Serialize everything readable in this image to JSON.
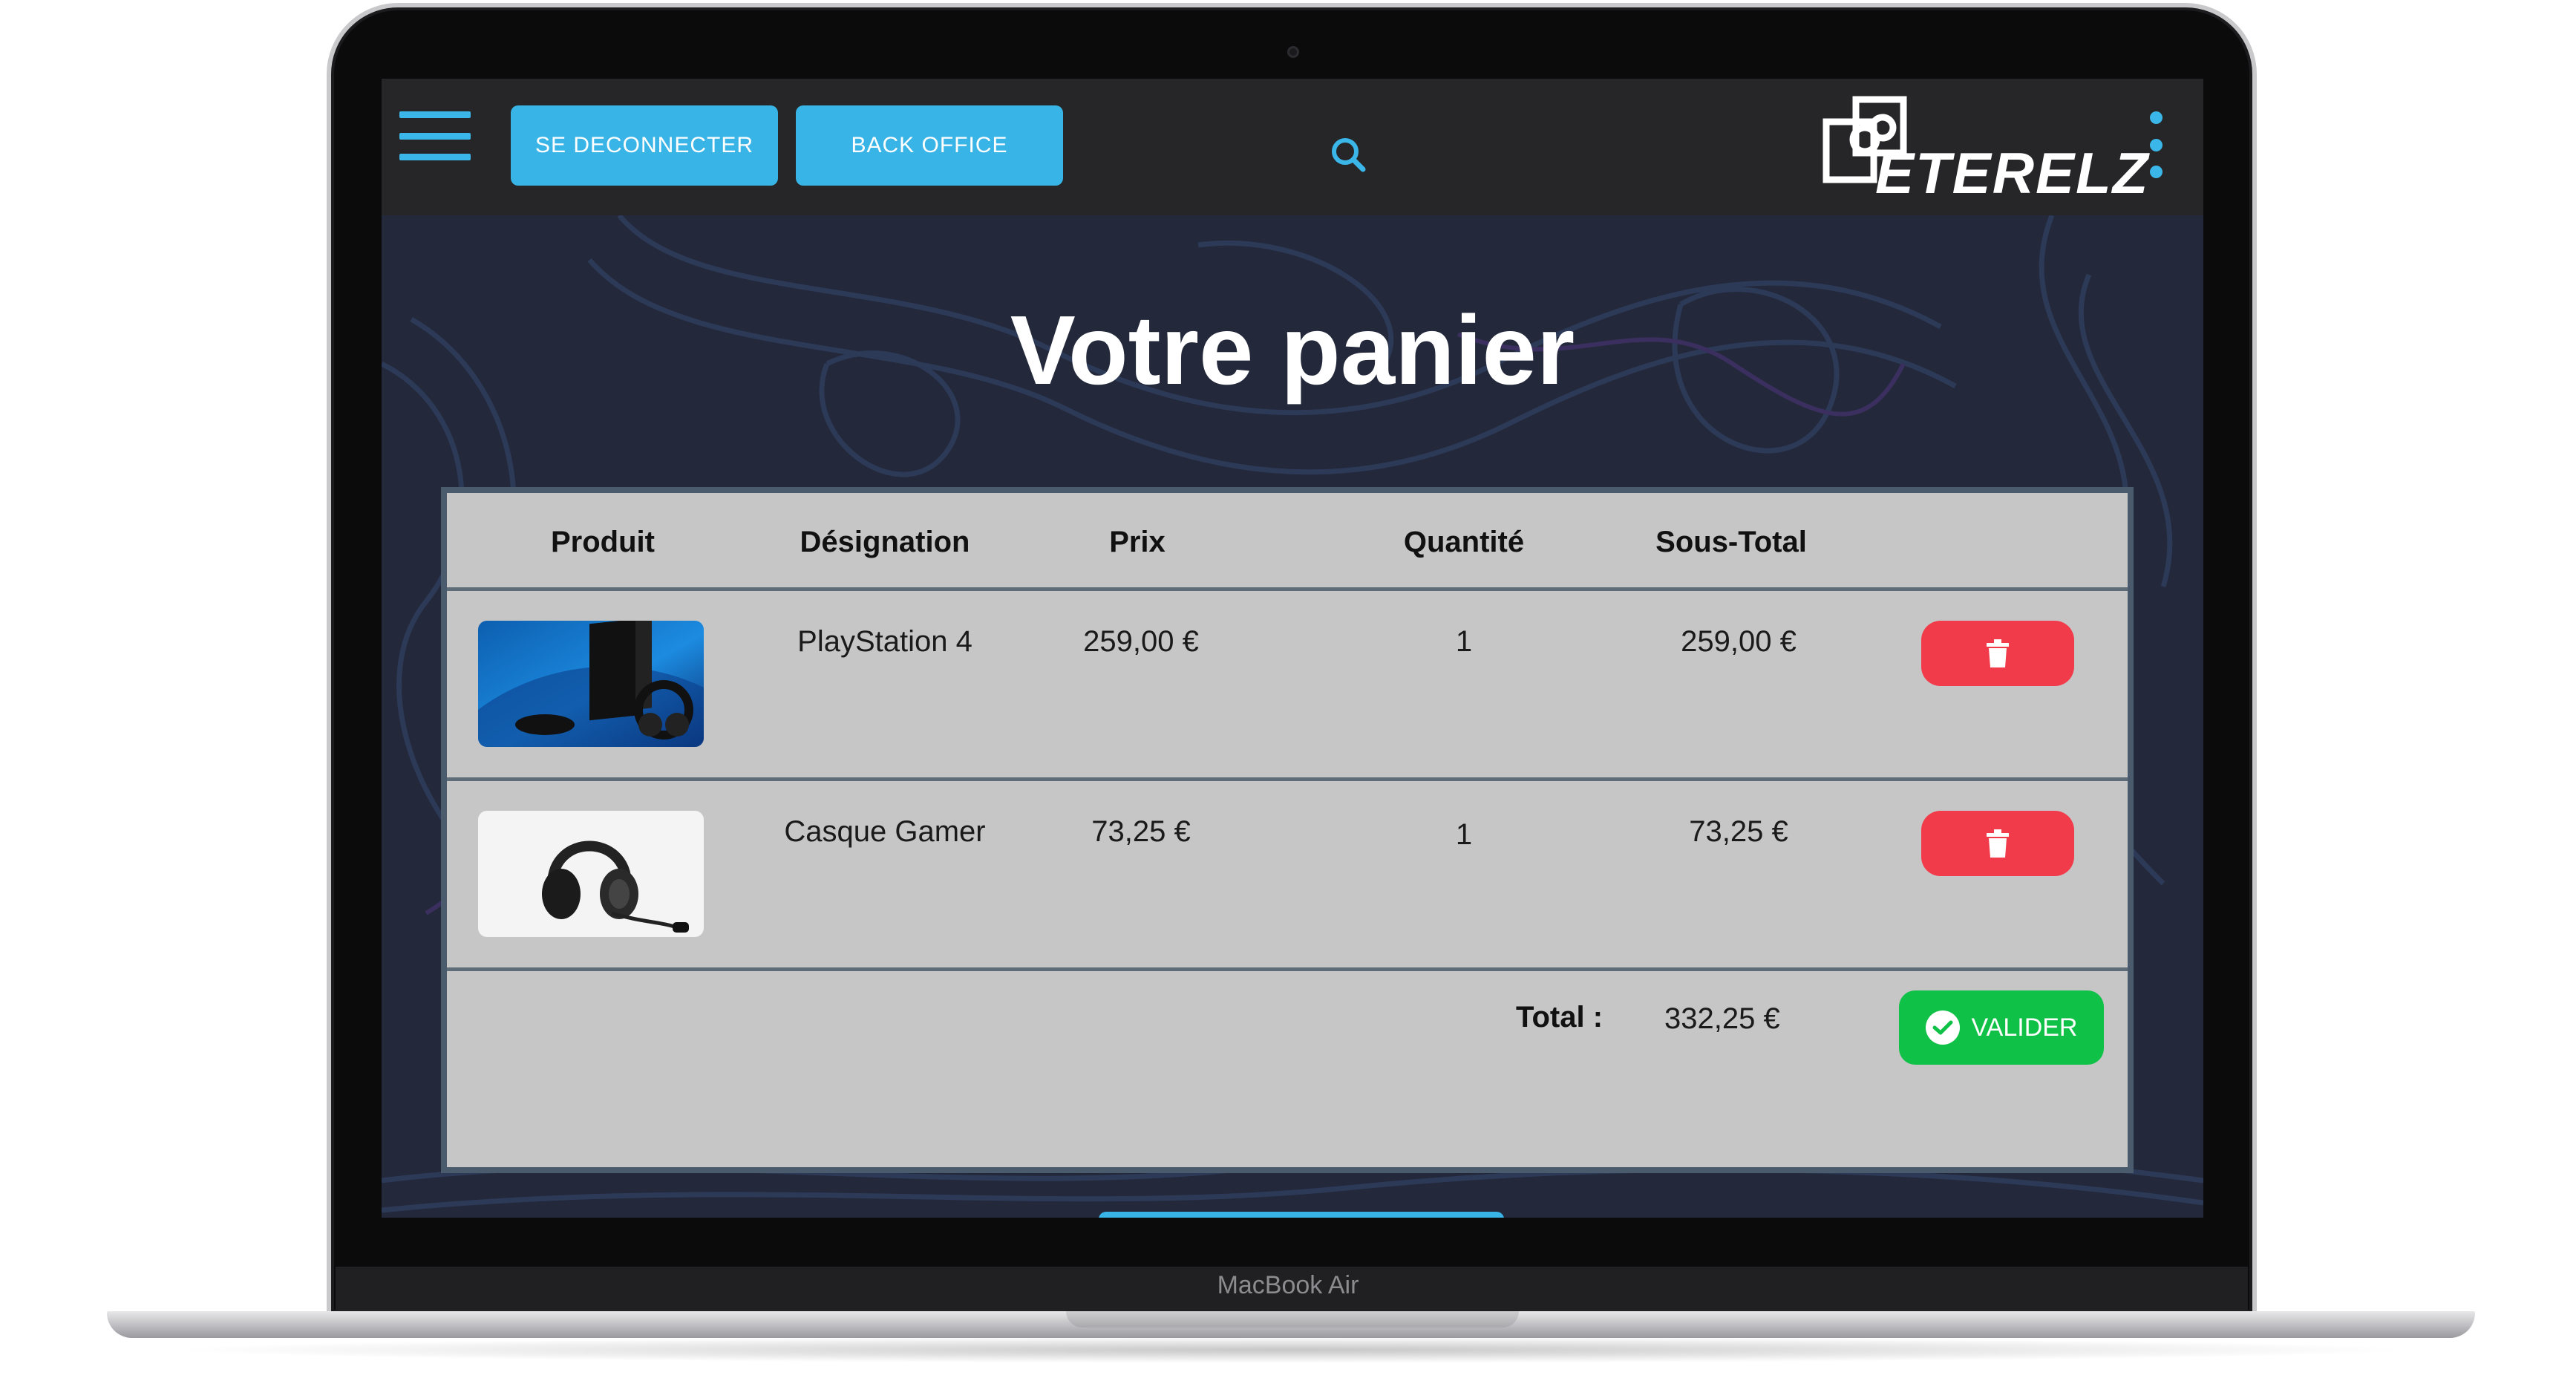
{
  "device": {
    "label": "MacBook Air"
  },
  "header": {
    "logout_label": "SE DECONNECTER",
    "backoffice_label": "BACK OFFICE",
    "logo_text": "ETERELZ",
    "menu_icon": "hamburger-menu-icon",
    "search_icon": "search-icon",
    "more_icon": "kebab-menu-icon"
  },
  "page": {
    "title": "Votre panier"
  },
  "cart": {
    "columns": [
      "Produit",
      "Désignation",
      "Prix",
      "Quantité",
      "Sous-Total"
    ],
    "items": [
      {
        "image": "playstation-4-image",
        "designation": "PlayStation 4",
        "price": "259,00 €",
        "quantity": "1",
        "subtotal": "259,00 €"
      },
      {
        "image": "gaming-headset-image",
        "designation": "Casque Gamer",
        "price": "73,25 €",
        "quantity": "1",
        "subtotal": "73,25 €"
      }
    ],
    "total_label": "Total :",
    "total_value": "332,25 €",
    "validate_label": "VALIDER"
  },
  "colors": {
    "accent": "#38b4e6",
    "delete": "#f23b4a",
    "validate": "#0fc146",
    "topbar": "#262628",
    "background": "#23283a",
    "table": "#c6c6c6"
  }
}
